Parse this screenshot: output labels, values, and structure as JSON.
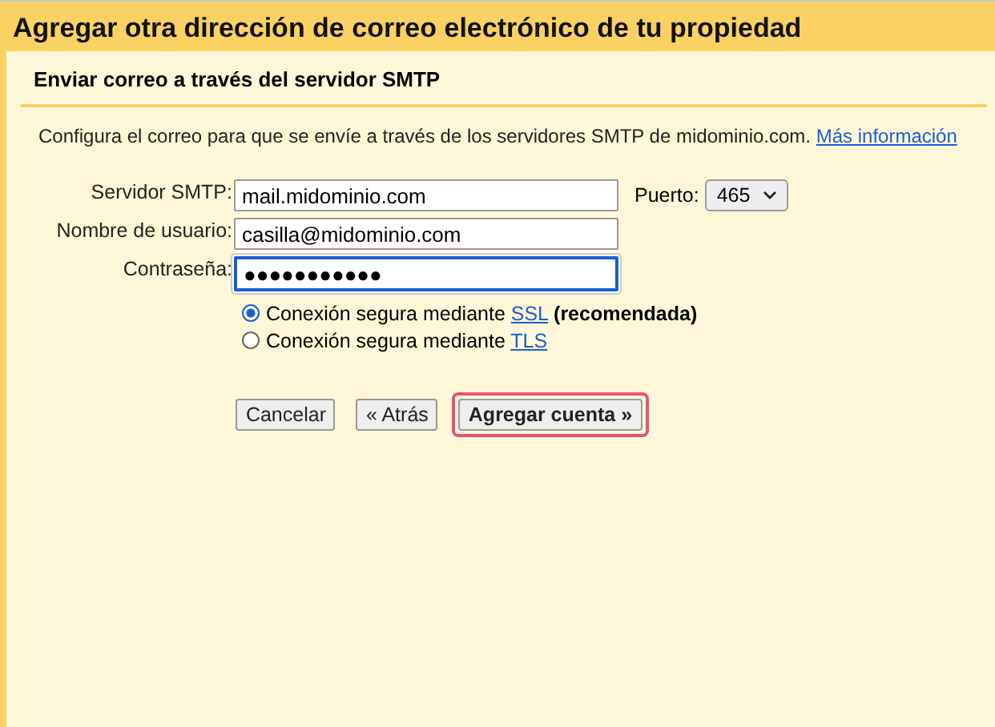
{
  "dialog": {
    "title": "Agregar otra dirección de correo electrónico de tu propiedad",
    "subtitle": "Enviar correo a través del servidor SMTP"
  },
  "intro": {
    "text": "Configura el correo para que se envíe a través de los servidores SMTP de midominio.com.",
    "link": "Más información"
  },
  "fields": [
    {
      "label": "Servidor SMTP:",
      "value": "mail.midominio.com",
      "focused": false
    },
    {
      "label": "Nombre de usuario:",
      "value": "casilla@midominio.com",
      "focused": false
    },
    {
      "label": "Contraseña:",
      "value": "●●●●●●●●●●●",
      "focused": true
    }
  ],
  "port": {
    "label": "Puerto:",
    "value": "465"
  },
  "security": [
    {
      "text": "Conexión segura mediante",
      "link": "SSL",
      "note": "(recomendada)",
      "selected": true
    },
    {
      "text": "Conexión segura mediante",
      "link": "TLS",
      "selected": false
    }
  ],
  "buttons": [
    {
      "label": "Cancelar",
      "primary": false,
      "highlighted": false
    },
    {
      "label": "« Atrás",
      "primary": false,
      "highlighted": false
    },
    {
      "label": "Agregar cuenta »",
      "primary": true,
      "highlighted": true
    }
  ]
}
